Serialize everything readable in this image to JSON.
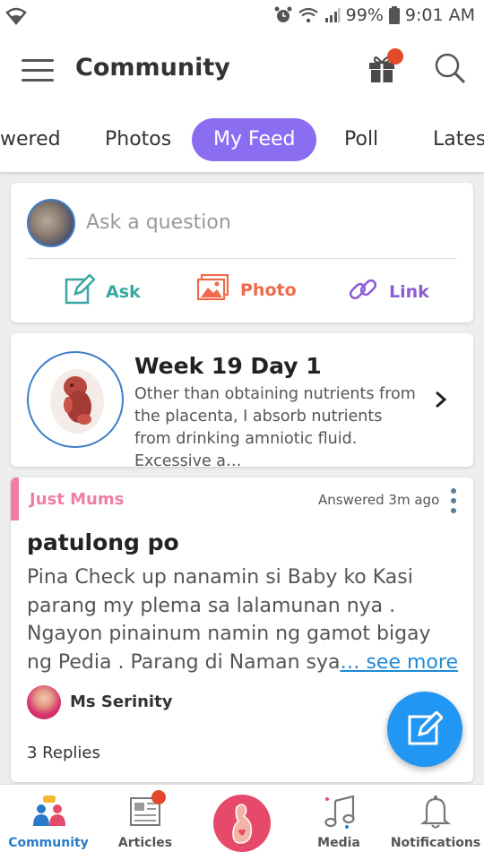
{
  "status_bar": {
    "battery": "99%",
    "time": "9:01 AM"
  },
  "app_bar": {
    "title": "Community"
  },
  "tabs": [
    {
      "label": "wered"
    },
    {
      "label": "Photos"
    },
    {
      "label": "My Feed",
      "active": true
    },
    {
      "label": "Poll"
    },
    {
      "label": "Lates"
    }
  ],
  "composer": {
    "placeholder": "Ask a question",
    "actions": [
      {
        "label": "Ask",
        "icon": "edit-icon",
        "color": "#3aa7a3"
      },
      {
        "label": "Photo",
        "icon": "image-icon",
        "color": "#ef6a4d"
      },
      {
        "label": "Link",
        "icon": "link-icon",
        "color": "#8b5cd6"
      }
    ]
  },
  "week_card": {
    "title": "Week 19 Day 1",
    "text": "Other than obtaining nutrients from the placenta, I absorb nutrients from drinking amniotic fluid. Excessive a…",
    "icon": "fetus-image"
  },
  "post": {
    "group": "Just Mums",
    "time": "Answered 3m ago",
    "title": "patulong po",
    "body": "Pina Check up nanamin si Baby ko Kasi parang my plema sa lalamunan nya . Ngayon pinainum namin ng gamot bigay ng Pedia . Parang di Naman sya",
    "see_more": "… see more",
    "author": "Ms Serinity",
    "replies": "3 Replies"
  },
  "bottom_nav": [
    {
      "label": "Community",
      "icon": "community-icon",
      "active": true
    },
    {
      "label": "Articles",
      "icon": "articles-icon"
    },
    {
      "label": "",
      "icon": "pregnancy-icon"
    },
    {
      "label": "Media",
      "icon": "music-icon"
    },
    {
      "label": "Notifications",
      "icon": "bell-icon"
    }
  ],
  "colors": {
    "accent": "#8b6df2",
    "fab": "#2196f3",
    "brand_pink": "#e64a6b",
    "badge": "#e2492a",
    "active_nav": "#2a7ac9"
  }
}
